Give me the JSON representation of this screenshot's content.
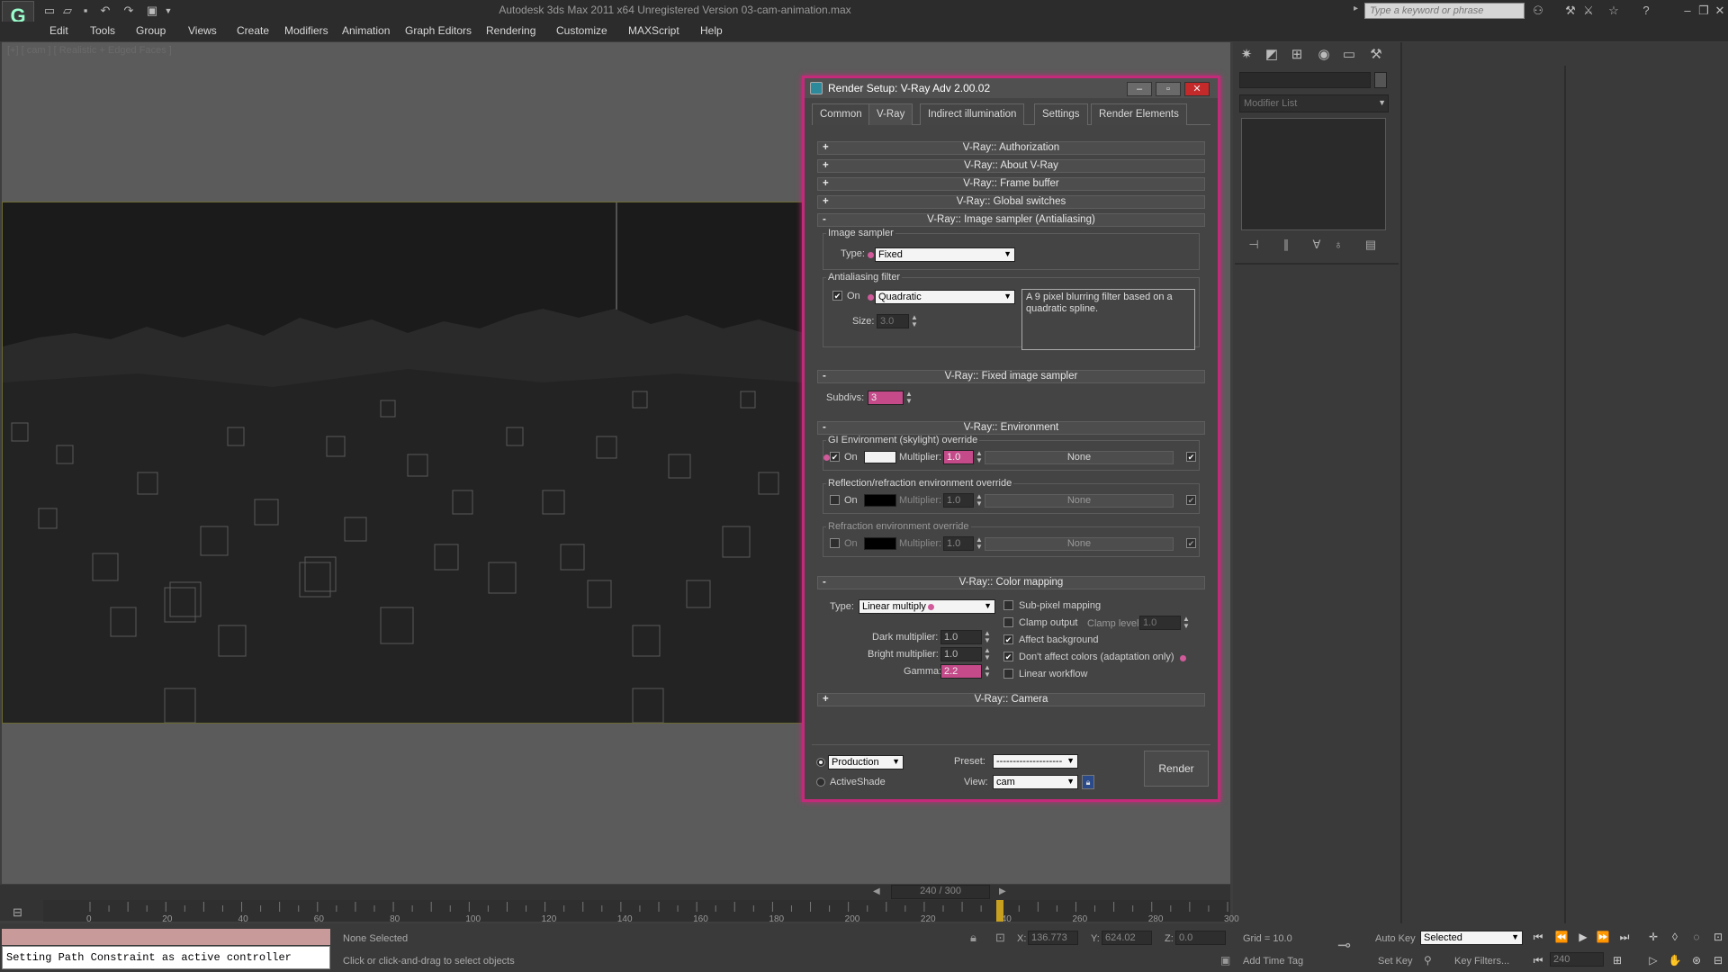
{
  "app": {
    "title": "Autodesk 3ds Max  2011 x64    Unregistered Version    03-cam-animation.max",
    "logo": "3ds-max-logo",
    "search_placeholder": "Type a keyword or phrase"
  },
  "menu": [
    "Edit",
    "Tools",
    "Group",
    "Views",
    "Create",
    "Modifiers",
    "Animation",
    "Graph Editors",
    "Rendering",
    "Customize",
    "MAXScript",
    "Help"
  ],
  "viewport": {
    "label": "[+] [ cam ] [ Realistic + Edged Faces ]"
  },
  "command_panel": {
    "modifier_list": "Modifier List"
  },
  "timeline": {
    "frame_counter": "240 / 300",
    "ticks": [
      "0",
      "20",
      "40",
      "60",
      "80",
      "100",
      "120",
      "140",
      "160",
      "180",
      "200",
      "220",
      "240",
      "260",
      "280",
      "300"
    ],
    "current_frame": 240,
    "total_frames": 300
  },
  "status": {
    "maxscript_output": "Setting Path Constraint as active controller",
    "selection": "None Selected",
    "prompt": "Click or click-and-drag to select objects",
    "x_label": "X:",
    "x": "136.773",
    "y_label": "Y:",
    "y": "624.02",
    "z_label": "Z:",
    "z": "0.0",
    "grid": "Grid = 10.0",
    "add_time_tag": "Add Time Tag",
    "auto_key": "Auto Key",
    "set_key": "Set Key",
    "selected": "Selected",
    "key_filters": "Key Filters...",
    "frame_field": "240"
  },
  "dialog": {
    "title": "Render Setup: V-Ray Adv 2.00.02",
    "tabs": [
      "Common",
      "V-Ray",
      "Indirect illumination",
      "Settings",
      "Render Elements"
    ],
    "active_tab": "V-Ray",
    "rollouts": {
      "authorization": "V-Ray:: Authorization",
      "about": "V-Ray:: About V-Ray",
      "frame_buffer": "V-Ray:: Frame buffer",
      "global_switches": "V-Ray:: Global switches",
      "image_sampler": "V-Ray:: Image sampler (Antialiasing)",
      "fixed_sampler": "V-Ray:: Fixed image sampler",
      "environment": "V-Ray:: Environment",
      "color_mapping": "V-Ray:: Color mapping",
      "camera": "V-Ray:: Camera"
    },
    "plus": "+",
    "minus": "-",
    "image_sampler": {
      "group": "Image sampler",
      "type_label": "Type:",
      "type": "Fixed"
    },
    "aa_filter": {
      "group": "Antialiasing filter",
      "on_label": "On",
      "on": true,
      "filter": "Quadratic",
      "description": "A 9 pixel blurring filter based on a quadratic spline.",
      "size_label": "Size:",
      "size": "3.0"
    },
    "fixed": {
      "subdivs_label": "Subdivs:",
      "subdivs": "3"
    },
    "environment": {
      "gi_group": "GI Environment (skylight) override",
      "refl_group": "Reflection/refraction environment override",
      "refr_group": "Refraction environment override",
      "on_label": "On",
      "multiplier_label": "Multiplier:",
      "gi_on": true,
      "gi_color": "#f2f2f2",
      "gi_multiplier": "1.0",
      "refl_on": false,
      "refl_color": "#000000",
      "refl_multiplier": "1.0",
      "refr_on": false,
      "refr_color": "#000000",
      "refr_multiplier": "1.0",
      "map": "None"
    },
    "color_mapping": {
      "type_label": "Type:",
      "type": "Linear multiply",
      "dark_label": "Dark multiplier:",
      "dark": "1.0",
      "bright_label": "Bright multiplier:",
      "bright": "1.0",
      "gamma_label": "Gamma:",
      "gamma": "2.2",
      "subpixel": "Sub-pixel mapping",
      "clamp_output": "Clamp output",
      "clamp_level_label": "Clamp level:",
      "clamp_level": "1.0",
      "affect_background": "Affect background",
      "dont_affect": "Don't affect colors (adaptation only)",
      "linear_workflow": "Linear workflow"
    },
    "bottom": {
      "production": "Production",
      "activeshade": "ActiveShade",
      "preset_label": "Preset:",
      "preset": "--------------------",
      "view_label": "View:",
      "view": "cam",
      "render": "Render"
    }
  },
  "colors": {
    "accent": "#c42a7a",
    "viewport_bg": "#5b5b5b",
    "frame_border": "#6c6a32"
  }
}
